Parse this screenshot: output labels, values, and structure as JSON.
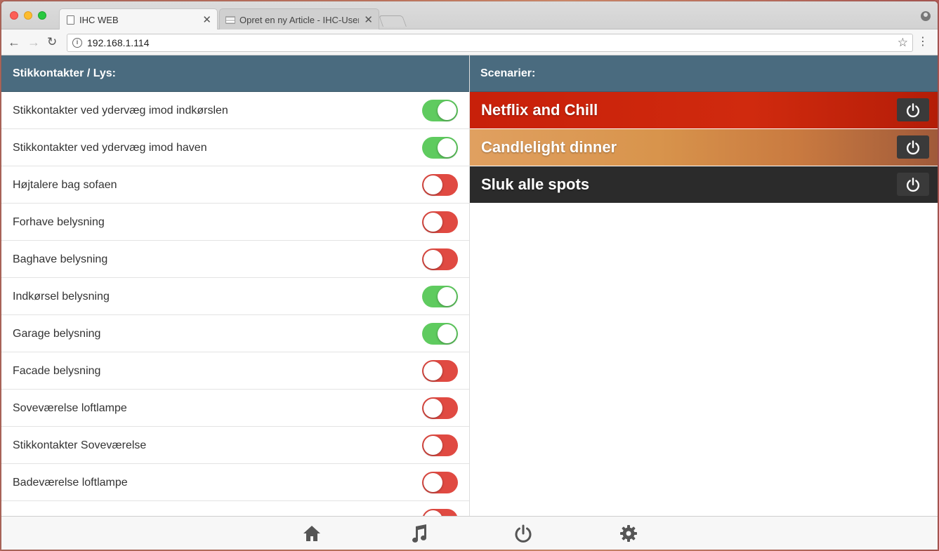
{
  "browser": {
    "tabs": [
      {
        "title": "IHC WEB",
        "close": "✕"
      },
      {
        "title": "Opret en ny Article - IHC-User",
        "close": "✕"
      }
    ],
    "url": "192.168.1.114",
    "info_glyph": "i"
  },
  "left_panel": {
    "header": "Stikkontakter / Lys:",
    "items": [
      {
        "label": "Stikkontakter ved ydervæg imod indkørslen",
        "on": true
      },
      {
        "label": "Stikkontakter ved ydervæg imod haven",
        "on": true
      },
      {
        "label": "Højtalere bag sofaen",
        "on": false
      },
      {
        "label": "Forhave belysning",
        "on": false
      },
      {
        "label": "Baghave belysning",
        "on": false
      },
      {
        "label": "Indkørsel belysning",
        "on": true
      },
      {
        "label": "Garage belysning",
        "on": true
      },
      {
        "label": "Facade belysning",
        "on": false
      },
      {
        "label": "Soveværelse loftlampe",
        "on": false
      },
      {
        "label": "Stikkontakter Soveværelse",
        "on": false
      },
      {
        "label": "Badeværelse loftlampe",
        "on": false
      },
      {
        "label": "",
        "on": false
      }
    ]
  },
  "right_panel": {
    "header": "Scenarier:",
    "scenes": [
      {
        "label": "Netflix and Chill",
        "background": "linear-gradient(90deg,#c8200a,#d02a0e 60%,#b41d08)"
      },
      {
        "label": "Candlelight dinner",
        "background": "linear-gradient(90deg,#e0a060,#d8944c 40%,#c97a40 70%,#a05a3a)"
      },
      {
        "label": "Sluk alle spots",
        "background": "#2b2b2b"
      }
    ]
  },
  "footer": {
    "icons": [
      "home-icon",
      "music-icon",
      "power-icon",
      "gear-icon"
    ]
  },
  "colors": {
    "header_bg": "#4a6b7f",
    "toggle_on": "#5fcb5f",
    "toggle_off": "#e04a42"
  }
}
